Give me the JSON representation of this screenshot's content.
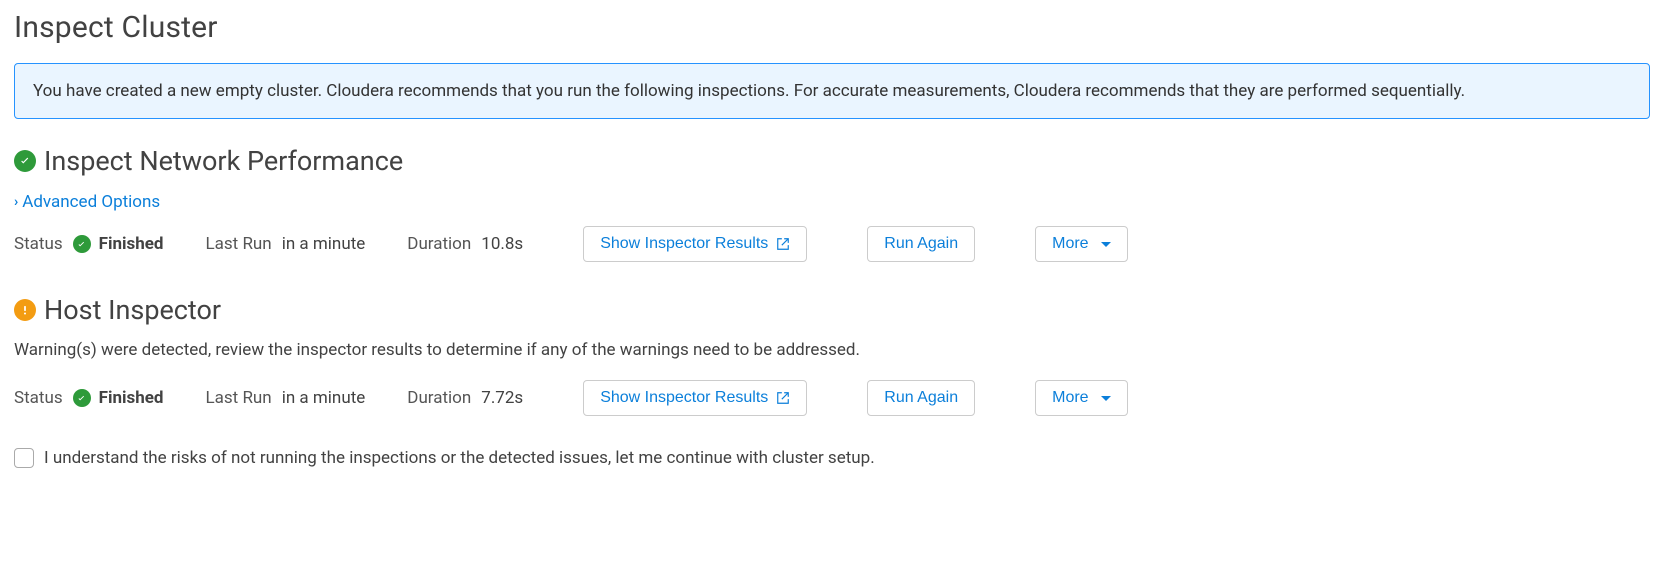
{
  "page_title": "Inspect Cluster",
  "info_message": "You have created a new empty cluster. Cloudera recommends that you run the following inspections. For accurate measurements, Cloudera recommends that they are performed sequentially.",
  "labels": {
    "status": "Status",
    "last_run": "Last Run",
    "duration": "Duration",
    "show_results": "Show Inspector Results",
    "run_again": "Run Again",
    "more": "More",
    "advanced_options": "Advanced Options"
  },
  "network": {
    "title": "Inspect Network Performance",
    "status_value": "Finished",
    "last_run_value": "in a minute",
    "duration_value": "10.8s"
  },
  "host": {
    "title": "Host Inspector",
    "description": "Warning(s) were detected, review the inspector results to determine if any of the warnings need to be addressed.",
    "status_value": "Finished",
    "last_run_value": "in a minute",
    "duration_value": "7.72s"
  },
  "acknowledge_label": "I understand the risks of not running the inspections or the detected issues, let me continue with cluster setup."
}
